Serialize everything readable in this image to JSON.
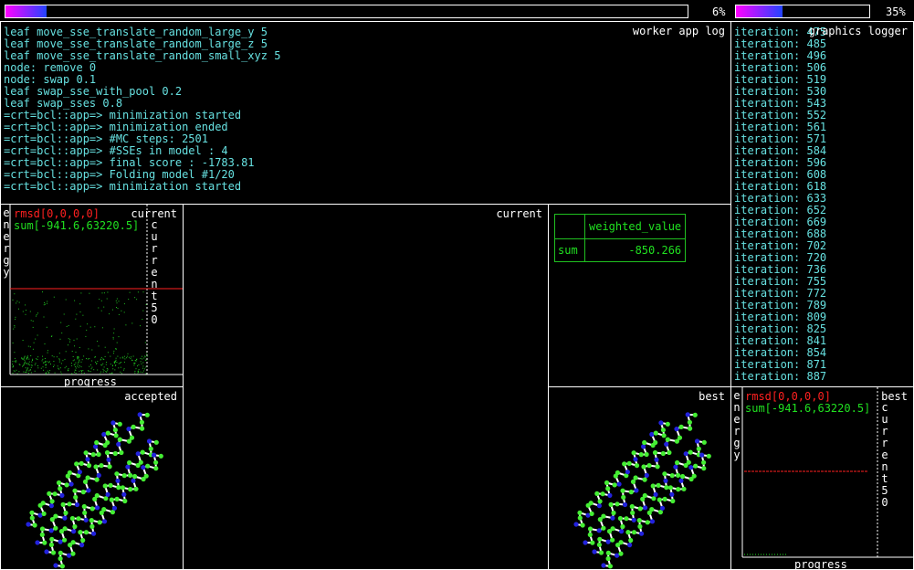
{
  "progress_left": {
    "fraction": 0.06,
    "label": "6%"
  },
  "progress_right": {
    "fraction": 0.35,
    "label": "35%"
  },
  "worker_log": {
    "title": "worker app log",
    "lines": [
      "leaf move_sse_translate_random_large_y 5",
      "leaf move_sse_translate_random_large_z 5",
      "leaf move_sse_translate_random_small_xyz 5",
      "node: remove 0",
      "node: swap 0.1",
      "leaf swap_sse_with_pool 0.2",
      "leaf swap_sses 0.8",
      "=crt=bcl::app=> minimization started",
      "=crt=bcl::app=> minimization ended",
      "=crt=bcl::app=> #MC steps: 2501",
      "=crt=bcl::app=> #SSEs in model : 4",
      "=crt=bcl::app=> final score : -1783.81",
      "=crt=bcl::app=> Folding model #1/20",
      "=crt=bcl::app=> minimization started"
    ]
  },
  "graphics_logger": {
    "title": "graphics logger",
    "lines": [
      "iteration: 475",
      "iteration: 485",
      "iteration: 496",
      "iteration: 506",
      "iteration: 519",
      "iteration: 530",
      "iteration: 543",
      "iteration: 552",
      "iteration: 561",
      "iteration: 571",
      "iteration: 584",
      "iteration: 596",
      "iteration: 608",
      "iteration: 618",
      "iteration: 633",
      "iteration: 652",
      "iteration: 669",
      "iteration: 688",
      "iteration: 702",
      "iteration: 720",
      "iteration: 736",
      "iteration: 755",
      "iteration: 772",
      "iteration: 789",
      "iteration: 809",
      "iteration: 825",
      "iteration: 841",
      "iteration: 854",
      "iteration: 871",
      "iteration: 887"
    ]
  },
  "plot_left": {
    "ylabel": "energy",
    "xlabel": "progress",
    "legend_rmsd": "rmsd[0,0,0,0]",
    "legend_sum": "sum[-941.6,63220.5]",
    "right_title": "current",
    "vertical_label_chars": [
      "c",
      "u",
      "r",
      "r",
      "e",
      "n",
      "t",
      "5",
      "0"
    ],
    "colors": {
      "rmsd": "#ff2020",
      "sum": "#20e020"
    }
  },
  "plot_right": {
    "ylabel": "energy",
    "xlabel": "progress",
    "legend_rmsd": "rmsd[0,0,0,0]",
    "legend_sum": "sum[-941.6,63220.5]",
    "right_title": "best",
    "vertical_label_chars": [
      "c",
      "u",
      "r",
      "r",
      "e",
      "n",
      "t",
      "5",
      "0"
    ]
  },
  "views": {
    "current": "current",
    "accepted": "accepted",
    "best": "best"
  },
  "score_table": {
    "header": "weighted_value",
    "row_label": "sum",
    "row_value": "-850.266",
    "border_color": "#20c020",
    "text_color": "#20e020"
  },
  "colors": {
    "atom_green": "#44ee33",
    "atom_blue": "#2222dd",
    "bond_white": "#ffffff",
    "progress_fill": "#5522ff"
  }
}
